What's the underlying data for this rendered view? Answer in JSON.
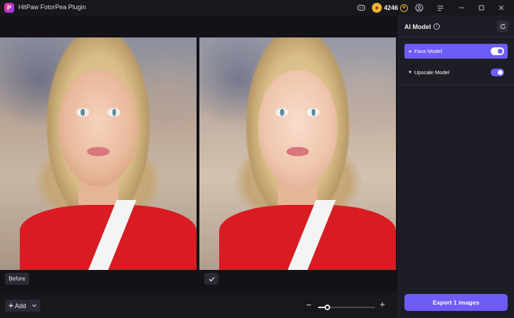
{
  "window": {
    "title": "HitPaw FotorPea Plugin",
    "logo_letter": "P",
    "controls": [
      "minimize-icon",
      "maximize-icon",
      "close-icon"
    ]
  },
  "titlebar": {
    "credits": {
      "count": "4246",
      "badge_glyph": "✦",
      "add_glyph": "+"
    },
    "icons": [
      "discord-icon",
      "account-icon",
      "menu-icon"
    ]
  },
  "canvas": {
    "before_label": "Before",
    "after_icon": "check-icon"
  },
  "bottom": {
    "add_label": "Add",
    "zoom": {
      "minus": "−",
      "plus": "+",
      "level_fraction": 0.16
    }
  },
  "panel": {
    "title": "AI Model",
    "models": [
      {
        "label": "Face Model",
        "active": true,
        "enabled": true
      },
      {
        "label": "Upscale Model",
        "active": false,
        "enabled": true
      }
    ],
    "export_label": "Export 1 images"
  },
  "colors": {
    "accent": "#6e5cf6",
    "credit_gold": "#f2b233",
    "background": "#121218",
    "panel": "#1d1d25"
  }
}
